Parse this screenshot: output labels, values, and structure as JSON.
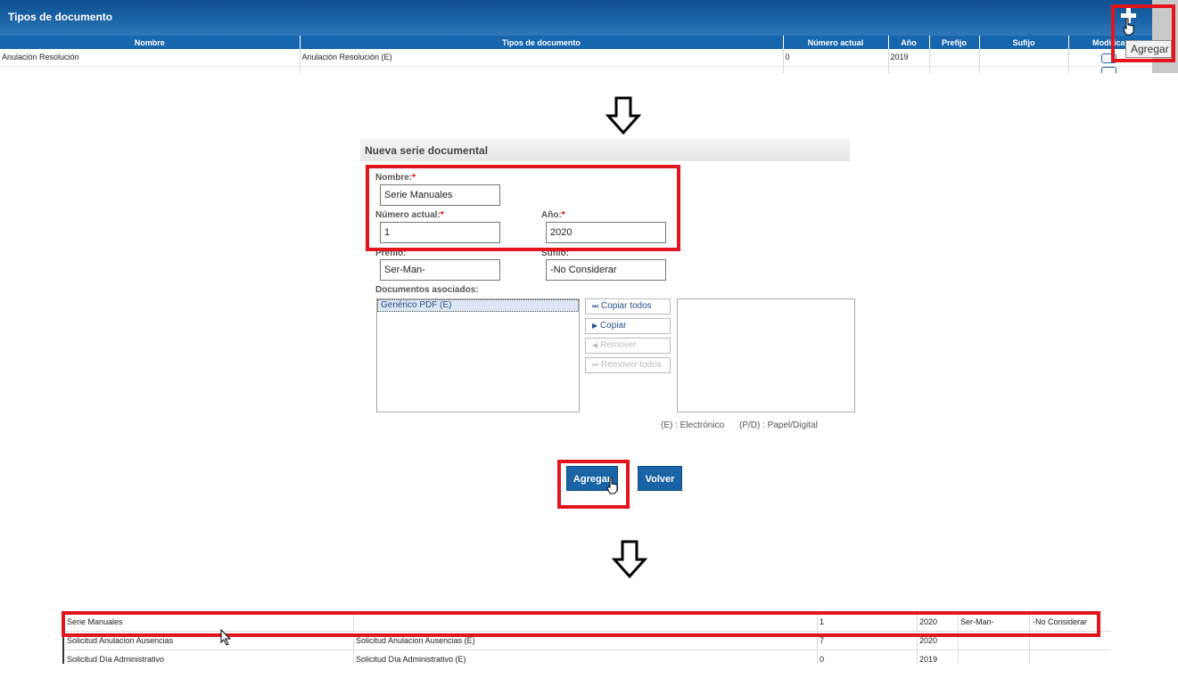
{
  "list_panel": {
    "title": "Tipos de documento",
    "columns": [
      "Nombre",
      "Tipos de documento",
      "Número actual",
      "Año",
      "Prefijo",
      "Sufijo",
      "Modificar"
    ],
    "rows": [
      {
        "nombre": "Anulación Resolución",
        "tipos": "Anulación Resolución (E)",
        "numero": "0",
        "anio": "2019",
        "prefijo": "",
        "sufijo": ""
      }
    ],
    "add_tooltip": "Agregar"
  },
  "form": {
    "title": "Nueva serie documental",
    "nombre_label": "Nombre:",
    "nombre_value": "Serie Manuales",
    "numero_label": "Número actual:",
    "numero_value": "1",
    "anio_label": "Año:",
    "anio_value": "2020",
    "prefijo_label": "Prefijo:",
    "prefijo_value": "Ser-Man-",
    "sufijo_label": "Sufijo:",
    "sufijo_value": "-No Considerar",
    "docs_label": "Documentos asociados:",
    "available_docs": [
      "Genérico PDF (E)"
    ],
    "copy_all": "Copiar todos",
    "copy": "Copiar",
    "remove": "Remover",
    "remove_all": "Remover todos",
    "legend_e": "(E) : Electrónico",
    "legend_pd": "(P/D) : Papel/Digital",
    "add_button": "Agregar",
    "back_button": "Volver",
    "required_mark": "*"
  },
  "result_rows": [
    {
      "nombre": "Serie Manuales",
      "tipos": "",
      "numero": "1",
      "anio": "2020",
      "prefijo": "Ser-Man-",
      "sufijo": "-No Considerar"
    },
    {
      "nombre": "Solicitud Anulacion Ausencias",
      "tipos": "Solicitud Anulacion Ausencias (E)",
      "numero": "7",
      "anio": "2020",
      "prefijo": "",
      "sufijo": ""
    },
    {
      "nombre": "Solicitud Día Administrativo",
      "tipos": "Solicitud Día Administrativo (E)",
      "numero": "0",
      "anio": "2019",
      "prefijo": "",
      "sufijo": ""
    }
  ],
  "colors": {
    "header_blue": "#1a63a6",
    "highlight_red": "#e4141c"
  }
}
